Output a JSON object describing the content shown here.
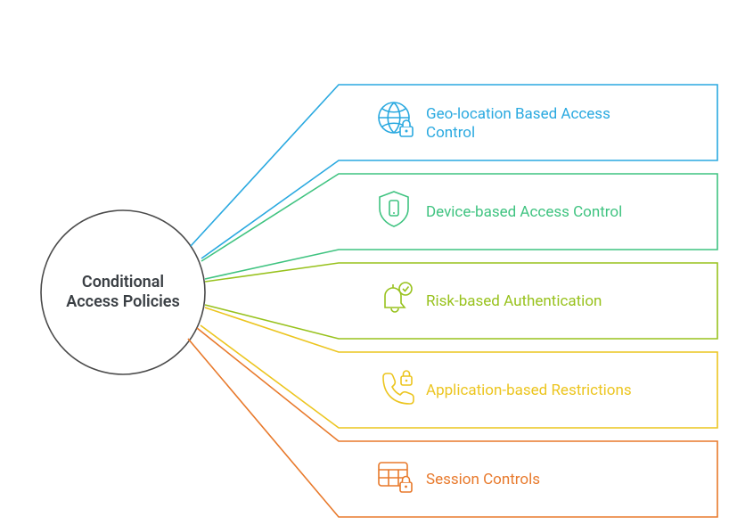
{
  "center": {
    "line1": "Conditional",
    "line2": "Access Policies"
  },
  "branches": [
    {
      "id": "geo",
      "label": "Geo-location Based Access Control",
      "label_line1": "Geo-location Based Access",
      "label_line2": "Control",
      "color": "#2aa9e0",
      "icon": "globe-lock-icon"
    },
    {
      "id": "device",
      "label": "Device-based Access Control",
      "color": "#3fc380",
      "icon": "shield-device-icon"
    },
    {
      "id": "risk",
      "label": "Risk-based Authentication",
      "color": "#98c21d",
      "icon": "bell-check-icon"
    },
    {
      "id": "app",
      "label": "Application-based Restrictions",
      "color": "#ecc51f",
      "icon": "phone-lock-icon"
    },
    {
      "id": "session",
      "label": "Session Controls",
      "color": "#e8792b",
      "icon": "table-lock-icon"
    }
  ]
}
